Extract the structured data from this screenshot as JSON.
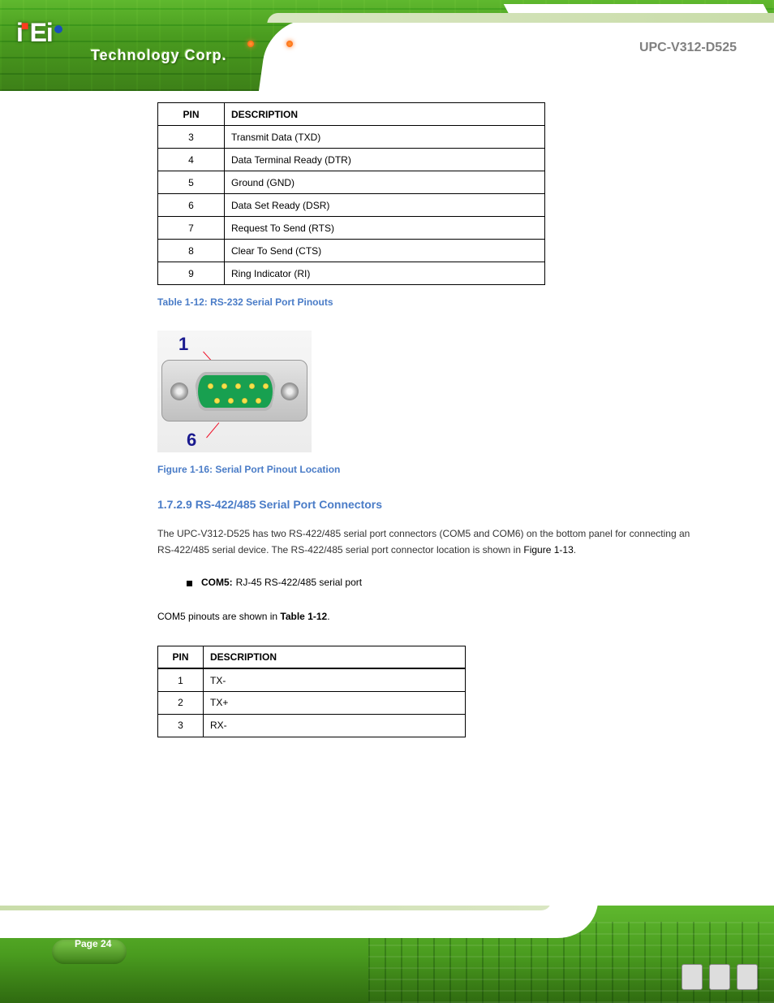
{
  "product_name": "UPC-V312-D525",
  "table1": {
    "headers": [
      "PIN",
      "DESCRIPTION"
    ],
    "rows": [
      [
        "3",
        "Transmit Data (TXD)"
      ],
      [
        "4",
        "Data Terminal Ready (DTR)"
      ],
      [
        "5",
        "Ground (GND)"
      ],
      [
        "6",
        "Data Set Ready (DSR)"
      ],
      [
        "7",
        "Request To Send (RTS)"
      ],
      [
        "8",
        "Clear To Send (CTS)"
      ],
      [
        "9",
        "Ring Indicator (RI)"
      ]
    ],
    "caption": "Table 1-12: RS-232 Serial Port Pinouts"
  },
  "figure": {
    "pin_top": "1",
    "pin_bot": "6",
    "caption": "Figure 1-16: Serial Port Pinout Location"
  },
  "section_heading": "1.7.2.9 RS-422/485 Serial Port Connectors",
  "body_text": "The UPC-V312-D525 has two RS-422/485 serial port connectors (COM5 and COM6) on the bottom panel for connecting an RS-422/485 serial device. The RS-422/485 serial port connector location is shown in",
  "body_text_link": "Figure 1-13",
  "bullet": {
    "label": "COM5:",
    "value": "RJ-45 RS-422/485 serial port"
  },
  "pinnote_pre": "COM5 pinouts are shown in ",
  "pinnote_link": "Table 1-12",
  "pinnote_post": ".",
  "table2": {
    "headers": [
      "PIN",
      "DESCRIPTION"
    ],
    "rows": [
      [
        "1",
        "TX-"
      ],
      [
        "2",
        "TX+"
      ],
      [
        "3",
        "RX-"
      ]
    ]
  },
  "page_number": "Page 24"
}
